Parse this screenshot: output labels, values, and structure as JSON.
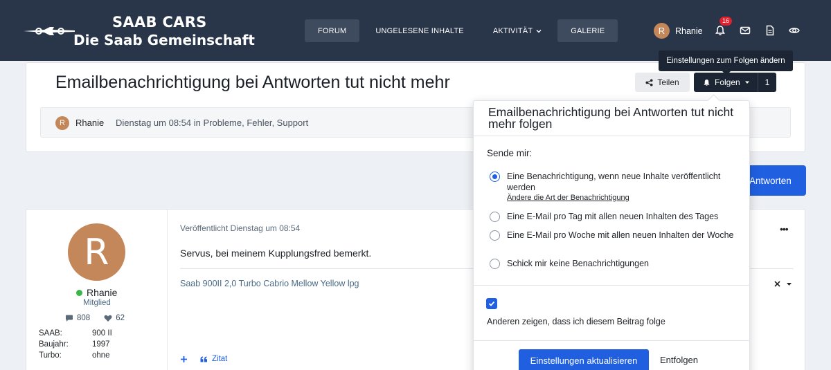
{
  "header": {
    "logo_title": "SAAB CARS",
    "logo_subtitle": "Die Saab Gemeinschaft",
    "nav": [
      "FORUM",
      "UNGELESENE INHALTE",
      "AKTIVITÄT",
      "GALERIE"
    ],
    "user_initial": "R",
    "user_name": "Rhanie",
    "notification_count": "16"
  },
  "thread": {
    "title": "Emailbenachrichtigung bei Antworten tut nicht mehr",
    "author_initial": "R",
    "author": "Rhanie",
    "meta": "Dienstag um 08:54 in Probleme, Fehler, Support",
    "share_label": "Teilen",
    "follow_label": "Folgen",
    "follow_count": "1",
    "tooltip": "Einstellungen zum Folgen ändern",
    "reply_label": "Antworten"
  },
  "post": {
    "avatar_initial": "R",
    "user": "Rhanie",
    "role": "Mitglied",
    "posts": "808",
    "likes": "62",
    "info": [
      {
        "key": "SAAB:",
        "value": "900 II"
      },
      {
        "key": "Baujahr:",
        "value": "1997"
      },
      {
        "key": "Turbo:",
        "value": "ohne"
      }
    ],
    "date": "Veröffentlicht Dienstag um 08:54",
    "body": "Servus, bei meinem Kupplungsfred bemerkt.",
    "signature": "Saab 900II 2,0 Turbo Cabrio Mellow Yellow lpg",
    "more_label": "•••",
    "quote_label": "Zitat"
  },
  "follow_menu": {
    "title": "Emailbenachrichtigung bei Antworten tut nicht mehr folgen",
    "send_label": "Sende mir:",
    "options": [
      {
        "text": "Eine Benachrichtigung, wenn neue Inhalte veröffentlicht werden",
        "link": "Ändere die Art der Benachrichtigung",
        "selected": true
      },
      {
        "text": "Eine E-Mail pro Tag mit allen neuen Inhalten des Tages",
        "selected": false
      },
      {
        "text": "Eine E-Mail pro Woche mit allen neuen Inhalten der Woche",
        "selected": false
      },
      {
        "text": "Schick mir keine Benachrichtigungen",
        "selected": false
      }
    ],
    "show_following_label": "Anderen zeigen, dass ich diesem Beitrag folge",
    "show_following_checked": true,
    "update_label": "Einstellungen aktualisieren",
    "unfollow_label": "Entfolgen"
  },
  "colors": {
    "header_bg": "#293548",
    "accent": "#1f5fe0",
    "avatar": "#c4875a",
    "online": "#3cb54a",
    "badge": "#e0202c"
  }
}
